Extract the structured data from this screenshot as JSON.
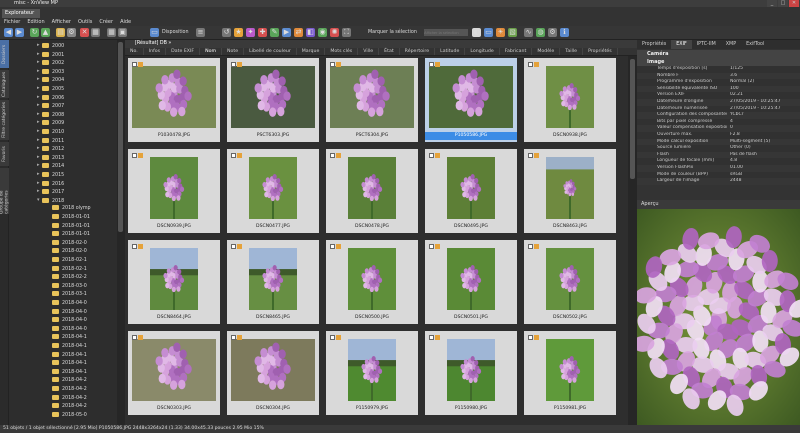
{
  "window": {
    "title": "misc - XnView MP",
    "buttons": [
      "_",
      "□",
      "✕"
    ]
  },
  "tabs": [
    "Explorateur"
  ],
  "menu": [
    "Fichier",
    "Edition",
    "Afficher",
    "Outils",
    "Créer",
    "Aide"
  ],
  "toolbar": {
    "disposition_label": "Disposition",
    "marker_label": "Marquer la sélection",
    "search_placeholder": "Afficher la sélection"
  },
  "sidetabs": [
    "Dossiers",
    "Catalogues",
    "Filtre catégories",
    "Favoris",
    "Groupe de catégories"
  ],
  "tree": [
    {
      "label": "2000",
      "type": "year"
    },
    {
      "label": "2001",
      "type": "year"
    },
    {
      "label": "2002",
      "type": "year"
    },
    {
      "label": "2003",
      "type": "year"
    },
    {
      "label": "2004",
      "type": "year"
    },
    {
      "label": "2005",
      "type": "year"
    },
    {
      "label": "2006",
      "type": "year"
    },
    {
      "label": "2007",
      "type": "year"
    },
    {
      "label": "2008",
      "type": "year"
    },
    {
      "label": "2009",
      "type": "year"
    },
    {
      "label": "2010",
      "type": "year"
    },
    {
      "label": "2011",
      "type": "year"
    },
    {
      "label": "2012",
      "type": "year"
    },
    {
      "label": "2013",
      "type": "year"
    },
    {
      "label": "2014",
      "type": "year"
    },
    {
      "label": "2015",
      "type": "year"
    },
    {
      "label": "2016",
      "type": "year"
    },
    {
      "label": "2017",
      "type": "year"
    },
    {
      "label": "2018",
      "type": "year-open"
    },
    {
      "label": "2018 olymp",
      "type": "sub"
    },
    {
      "label": "2018-01-01",
      "type": "sub"
    },
    {
      "label": "2018-01-01",
      "type": "sub"
    },
    {
      "label": "2018-01-01",
      "type": "sub"
    },
    {
      "label": "2018-02-0",
      "type": "sub"
    },
    {
      "label": "2018-02-0",
      "type": "sub"
    },
    {
      "label": "2018-02-1",
      "type": "sub"
    },
    {
      "label": "2018-02-1",
      "type": "sub"
    },
    {
      "label": "2018-02-2",
      "type": "sub"
    },
    {
      "label": "2018-03-0",
      "type": "sub"
    },
    {
      "label": "2018-03-1",
      "type": "sub"
    },
    {
      "label": "2018-04-0",
      "type": "sub"
    },
    {
      "label": "2018-04-0",
      "type": "sub"
    },
    {
      "label": "2018-04-0",
      "type": "sub"
    },
    {
      "label": "2018-04-0",
      "type": "sub"
    },
    {
      "label": "2018-04-1",
      "type": "sub"
    },
    {
      "label": "2018-04-1",
      "type": "sub"
    },
    {
      "label": "2018-04-1",
      "type": "sub"
    },
    {
      "label": "2018-04-1",
      "type": "sub"
    },
    {
      "label": "2018-04-1",
      "type": "sub"
    },
    {
      "label": "2018-04-2",
      "type": "sub"
    },
    {
      "label": "2018-04-2",
      "type": "sub"
    },
    {
      "label": "2018-04-2",
      "type": "sub"
    },
    {
      "label": "2018-04-2",
      "type": "sub"
    },
    {
      "label": "2018-05-0",
      "type": "sub"
    }
  ],
  "browser": {
    "path": "[Résultat] DB »",
    "filters": [
      "No.",
      "Infos",
      "Date EXIF",
      "Nom",
      "Note",
      "Libellé de couleur",
      "Marque",
      "Mots clés",
      "Ville",
      "État",
      "Répertoire",
      "Latitude",
      "Longitude",
      "Fabricant",
      "Modèle",
      "Taille",
      "Propriétés"
    ],
    "thumbnails": [
      {
        "name": "P1030478.JPG",
        "scene": "closeup",
        "bg": "#7a8a55"
      },
      {
        "name": "PSCT6303.JPG",
        "scene": "closeup",
        "bg": "#4a5a40"
      },
      {
        "name": "PSCT6304.JPG",
        "scene": "closeup",
        "bg": "#6d7f55"
      },
      {
        "name": "P1050586.JPG",
        "scene": "closeup",
        "bg": "#4f6a3a",
        "selected": true
      },
      {
        "name": "DSCN0938.JPG",
        "scene": "field",
        "bg": "#6f8f45"
      },
      {
        "name": "DSCN0939.JPG",
        "scene": "field",
        "bg": "#5e8a3e"
      },
      {
        "name": "DSCN0477.JPG",
        "scene": "field",
        "bg": "#6a9140"
      },
      {
        "name": "DSCN0478.JPG",
        "scene": "field",
        "bg": "#5a8038"
      },
      {
        "name": "DSCN0495.JPG",
        "scene": "field",
        "bg": "#5d7f36"
      },
      {
        "name": "DSCN8463.JPG",
        "scene": "meadow",
        "bg": "#6f8a40"
      },
      {
        "name": "DSCN8464.JPG",
        "scene": "sky",
        "bg": "#5f8a3e"
      },
      {
        "name": "DSCN8465.JPG",
        "scene": "sky",
        "bg": "#678f43"
      },
      {
        "name": "DSCN0500.JPG",
        "scene": "field",
        "bg": "#5f8f3a"
      },
      {
        "name": "DSCN0501.JPG",
        "scene": "field",
        "bg": "#5a8a36"
      },
      {
        "name": "DSCN0502.JPG",
        "scene": "field",
        "bg": "#65913f"
      },
      {
        "name": "DSCN0303.JPG",
        "scene": "closeup",
        "bg": "#8a8a6a"
      },
      {
        "name": "DSCN0304.JPG",
        "scene": "closeup",
        "bg": "#7d7a5c"
      },
      {
        "name": "P1150979.JPG",
        "scene": "sky",
        "bg": "#4f8a30"
      },
      {
        "name": "P1150980.JPG",
        "scene": "sky",
        "bg": "#4d8730"
      },
      {
        "name": "P1150981.JPG",
        "scene": "field",
        "bg": "#5f9a3a"
      }
    ]
  },
  "properties": {
    "tabs": [
      "Propriétés",
      "EXIF",
      "IPTC-IIM",
      "XMP",
      "ExifTool"
    ],
    "active_tab": "EXIF",
    "sections": {
      "camera": "Caméra",
      "image": "Image"
    },
    "rows": [
      {
        "k": "Temps d'exposition [s]",
        "v": "1/125"
      },
      {
        "k": "Nombre F",
        "v": "3.6"
      },
      {
        "k": "Programme d'exposition",
        "v": "Normal (2)"
      },
      {
        "k": "Sensibilité équivalente ISO",
        "v": "100"
      },
      {
        "k": "Version EXIF",
        "v": "02.21"
      },
      {
        "k": "Date/heure d'origine",
        "v": "27/05/2019 - 10:25:47"
      },
      {
        "k": "Date/heure numérisée",
        "v": "27/05/2019 - 10:25:47"
      },
      {
        "k": "Configuration des composantes",
        "v": "YCbCr"
      },
      {
        "k": "Bits par pixel compressé",
        "v": "4"
      },
      {
        "k": "Valeur compensation exposition",
        "v": "0"
      },
      {
        "k": "Ouverture max.",
        "v": "F2.8"
      },
      {
        "k": "Mode calcul exposition",
        "v": "Multi-segment (5)"
      },
      {
        "k": "Source lumière",
        "v": "Other (0)"
      },
      {
        "k": "Flash",
        "v": "Pas de flash"
      },
      {
        "k": "Longueur de focale [mm]",
        "v": "4.8"
      },
      {
        "k": "Version FlashPix",
        "v": "01.00"
      },
      {
        "k": "Mode de couleur (BPP)",
        "v": "sRGB"
      },
      {
        "k": "Largeur de l'image",
        "v": "2448"
      }
    ]
  },
  "preview": {
    "title": "Aperçu"
  },
  "status": "51 objets / 1 objet sélectionné [2.95 Mio]   P1050586.JPG   2448x3264x24 (1.33)   34.00x45.33 pouces   2.95 Mio   15%",
  "colors": {
    "accent": "#3c8ce6",
    "folder": "#e8c35a",
    "star": "#e5a23a",
    "flower": "#b87ac4"
  }
}
